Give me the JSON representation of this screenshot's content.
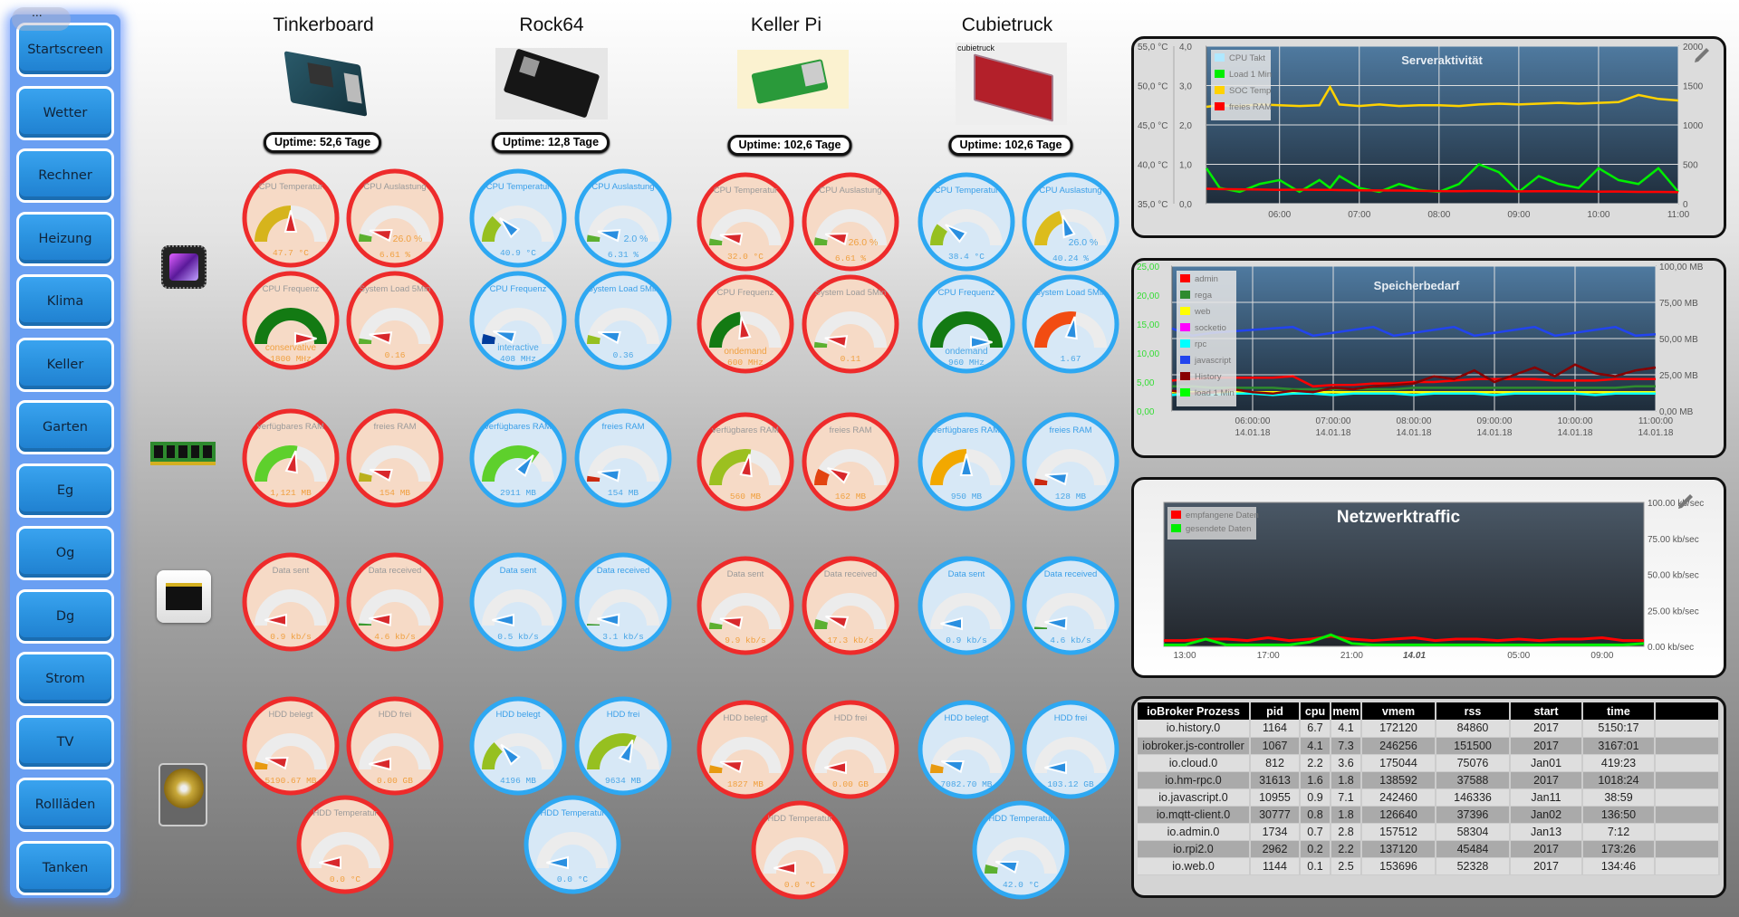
{
  "sidebar": {
    "menu_dots": "...",
    "items": [
      "Startscreen",
      "Wetter",
      "Rechner",
      "Heizung",
      "Klima",
      "Keller",
      "Garten",
      "Eg",
      "Og",
      "Dg",
      "Strom",
      "TV",
      "Rollläden",
      "Tanken"
    ]
  },
  "row_icons": [
    "cpu-chip-icon",
    "ram-module-icon",
    "ethernet-port-icon",
    "hard-disk-icon"
  ],
  "themes": {
    "red": {
      "border": "#ee2b2b",
      "bg": "#f6dac6",
      "title": "#9a9a9a",
      "value": "#f0a040",
      "needle": "#d8282c"
    },
    "blue": {
      "border": "#2ea8f2",
      "bg": "#d7e8f6",
      "title": "#3a9fe8",
      "value": "#4aa6e6",
      "needle": "#2a8fe0"
    }
  },
  "devices": [
    {
      "name": "Tinkerboard",
      "uptime": "Uptime: 52,6 Tage",
      "theme": "red",
      "gauges": [
        {
          "label": "CPU Temperatur",
          "value": "47.7 °C",
          "fill": 0.5,
          "color": "#d6b41c"
        },
        {
          "label": "CPU Auslastung",
          "extra": "26.0 %",
          "value": "6.61 %",
          "fill": 0.07,
          "color": "#5cb030"
        },
        {
          "label": "CPU Frequenz",
          "sub": "conservative",
          "value": "1800 MHz",
          "fill": 1.0,
          "color": "#137a13"
        },
        {
          "label": "System Load 5Min",
          "value": "0.16",
          "fill": 0.05,
          "color": "#5cb030"
        },
        {
          "label": "verfügbares RAM",
          "value": "1,121 MB",
          "fill": 0.56,
          "color": "#5ed02c"
        },
        {
          "label": "freies RAM",
          "value": "154 MB",
          "fill": 0.08,
          "color": "#bab01e"
        },
        {
          "label": "Data sent",
          "value": "0.9 kb/s",
          "fill": 0.0,
          "color": "#5cb030"
        },
        {
          "label": "Data received",
          "value": "4.6 kb/s",
          "fill": 0.02,
          "color": "#3a9a30"
        },
        {
          "label": "HDD belegt",
          "value": "5190.67 MB",
          "fill": 0.07,
          "color": "#e89a10"
        },
        {
          "label": "HDD frei",
          "value": "0.00 GB",
          "fill": 0.0,
          "color": "#5cb030"
        },
        {
          "label": "HDD Temperatur",
          "value": "0.0 °C",
          "fill": 0.0,
          "color": "#5cb030"
        }
      ]
    },
    {
      "name": "Rock64",
      "uptime": "Uptime: 12,8 Tage",
      "theme": "blue",
      "gauges": [
        {
          "label": "CPU Temperatur",
          "value": "40.9 °C",
          "fill": 0.25,
          "color": "#96c020"
        },
        {
          "label": "CPU Auslastung",
          "extra": "2.0 %",
          "value": "6.31 %",
          "fill": 0.06,
          "color": "#5cb030"
        },
        {
          "label": "CPU Frequenz",
          "sub": "interactive",
          "value": "408 MHz",
          "fill": 0.09,
          "color": "#003c9c"
        },
        {
          "label": "System Load 5Min",
          "value": "0.36",
          "fill": 0.08,
          "color": "#96c020"
        },
        {
          "label": "verfügbares RAM",
          "value": "2911 MB",
          "fill": 0.7,
          "color": "#5ed02c"
        },
        {
          "label": "freies RAM",
          "value": "154 MB",
          "fill": 0.05,
          "color": "#cc2a10"
        },
        {
          "label": "Data sent",
          "value": "0.5 kb/s",
          "fill": 0.0,
          "color": "#5cb030"
        },
        {
          "label": "Data received",
          "value": "3.1 kb/s",
          "fill": 0.015,
          "color": "#3a9a30"
        },
        {
          "label": "HDD belegt",
          "value": "4196 MB",
          "fill": 0.27,
          "color": "#96c020"
        },
        {
          "label": "HDD frei",
          "value": "9634 MB",
          "fill": 0.62,
          "color": "#96c020"
        },
        {
          "label": "HDD Temperatur",
          "value": "0.0 °C",
          "fill": 0.0,
          "color": "#5cb030"
        }
      ]
    },
    {
      "name": "Keller Pi",
      "uptime": "Uptime: 102,6 Tage",
      "theme": "red",
      "gauges": [
        {
          "label": "CPU Temperatur",
          "value": "32.0 °C",
          "fill": 0.06,
          "color": "#5cb030"
        },
        {
          "label": "CPU Auslastung",
          "extra": "26.0 %",
          "value": "6.61 %",
          "fill": 0.07,
          "color": "#5cb030"
        },
        {
          "label": "CPU Frequenz",
          "sub": "ondemand",
          "value": "600 MHz",
          "fill": 0.45,
          "color": "#137a13"
        },
        {
          "label": "System Load 5Min",
          "value": "0.11",
          "fill": 0.05,
          "color": "#5cb030"
        },
        {
          "label": "verfügbares RAM",
          "value": "560 MB",
          "fill": 0.55,
          "color": "#9cc020"
        },
        {
          "label": "freies RAM",
          "value": "162 MB",
          "fill": 0.15,
          "color": "#e24410"
        },
        {
          "label": "Data sent",
          "value": "9.9 kb/s",
          "fill": 0.06,
          "color": "#5cb030"
        },
        {
          "label": "Data received",
          "value": "17.3 kb/s",
          "fill": 0.09,
          "color": "#5cb030"
        },
        {
          "label": "HDD belegt",
          "value": "1827 MB",
          "fill": 0.07,
          "color": "#e89a10"
        },
        {
          "label": "HDD frei",
          "value": "0.00 GB",
          "fill": 0.0,
          "color": "#5cb030"
        },
        {
          "label": "HDD Temperatur",
          "value": "0.0 °C",
          "fill": 0.0,
          "color": "#5cb030"
        }
      ]
    },
    {
      "name": "Cubietruck",
      "image_label": "cubietruck",
      "uptime": "Uptime: 102,6 Tage",
      "theme": "blue",
      "gauges": [
        {
          "label": "CPU Temperatur",
          "value": "38.4 °C",
          "fill": 0.2,
          "color": "#96c020"
        },
        {
          "label": "CPU Auslastung",
          "extra": "26.0 %",
          "value": "40.24 %",
          "fill": 0.4,
          "color": "#dcbc1c"
        },
        {
          "label": "CPU Frequenz",
          "sub": "ondemand",
          "value": "960 MHz",
          "fill": 1.0,
          "color": "#137a13"
        },
        {
          "label": "System Load 5Min",
          "value": "1.67",
          "fill": 0.55,
          "color": "#f24c12"
        },
        {
          "label": "verfügbares RAM",
          "value": "950 MB",
          "fill": 0.5,
          "color": "#f2a800"
        },
        {
          "label": "freies RAM",
          "value": "128 MB",
          "fill": 0.06,
          "color": "#cc2a10"
        },
        {
          "label": "Data sent",
          "value": "0.9 kb/s",
          "fill": 0.0,
          "color": "#5cb030"
        },
        {
          "label": "Data received",
          "value": "4.6 kb/s",
          "fill": 0.02,
          "color": "#3a9a30"
        },
        {
          "label": "HDD belegt",
          "value": "7082.70 MB",
          "fill": 0.08,
          "color": "#e89a10"
        },
        {
          "label": "HDD frei",
          "value": "103.12 GB",
          "fill": 0.0,
          "color": "#5cb030"
        },
        {
          "label": "HDD Temperatur",
          "value": "42.0 °C",
          "fill": 0.08,
          "color": "#5cb030"
        }
      ]
    }
  ],
  "chart_data": [
    {
      "type": "line",
      "title": "Serveraktivität",
      "grid": true,
      "legend": "top-left",
      "x": [
        "05:05",
        "05:15",
        "05:30",
        "05:45",
        "06:00",
        "06:15",
        "06:30",
        "06:38",
        "06:45",
        "07:00",
        "07:15",
        "07:30",
        "07:45",
        "08:00",
        "08:15",
        "08:30",
        "08:45",
        "09:00",
        "09:15",
        "09:30",
        "09:45",
        "10:00",
        "10:15",
        "10:30",
        "10:45",
        "11:00"
      ],
      "xticks": [
        "06:00",
        "07:00",
        "08:00",
        "09:00",
        "10:00",
        "11:00"
      ],
      "axes": {
        "temp": {
          "ticks": [
            "35,0 °C",
            "40,0 °C",
            "45,0 °C",
            "50,0 °C",
            "55,0 °C"
          ],
          "range": [
            35,
            55
          ]
        },
        "load": {
          "ticks": [
            "0,0",
            "1,0",
            "2,0",
            "3,0",
            "4,0"
          ],
          "range": [
            0,
            4
          ]
        },
        "right": {
          "ticks": [
            "0",
            "500",
            "1000",
            "1500",
            "2000"
          ],
          "range": [
            0,
            2000
          ]
        }
      },
      "series": [
        {
          "name": "CPU Takt",
          "color": "#b0e8ff",
          "axis": "right",
          "values": []
        },
        {
          "name": "Load 1 Min",
          "color": "#00ee00",
          "axis": "load",
          "values": [
            0.9,
            0.4,
            0.3,
            0.5,
            0.6,
            0.3,
            0.6,
            0.4,
            0.7,
            0.4,
            0.3,
            0.5,
            0.35,
            0.3,
            0.5,
            1.0,
            0.8,
            0.3,
            0.7,
            0.5,
            0.4,
            0.9,
            0.6,
            0.5,
            0.9,
            0.3
          ]
        },
        {
          "name": "SOC Temp",
          "color": "#ffd200",
          "axis": "temp",
          "values": [
            47.3,
            47.5,
            47.4,
            47.6,
            47.5,
            47.4,
            47.5,
            49.8,
            47.6,
            47.4,
            47.6,
            47.4,
            47.5,
            47.5,
            47.4,
            47.6,
            47.7,
            47.6,
            47.7,
            47.8,
            47.7,
            47.8,
            47.9,
            48.8,
            48.3,
            48.1
          ]
        },
        {
          "name": "freies RAM",
          "color": "#ff0000",
          "axis": "right",
          "values": [
            190,
            185,
            182,
            180,
            176,
            178,
            175,
            175,
            172,
            170,
            168,
            166,
            164,
            160,
            158,
            162,
            160,
            156,
            158,
            160,
            156,
            152,
            154,
            150,
            150,
            146
          ]
        }
      ]
    },
    {
      "type": "line",
      "title": "Speicherbedarf",
      "grid": true,
      "legend": "top-left",
      "x": [
        "05:00",
        "05:15",
        "05:30",
        "05:45",
        "06:00",
        "06:15",
        "06:30",
        "06:45",
        "07:00",
        "07:15",
        "07:30",
        "07:45",
        "08:00",
        "08:15",
        "08:30",
        "08:45",
        "09:00",
        "09:15",
        "09:30",
        "09:45",
        "10:00",
        "10:15",
        "10:30",
        "10:45",
        "11:00"
      ],
      "xticks": [
        [
          "06:00:00",
          "14.01.18"
        ],
        [
          "07:00:00",
          "14.01.18"
        ],
        [
          "08:00:00",
          "14.01.18"
        ],
        [
          "09:00:00",
          "14.01.18"
        ],
        [
          "10:00:00",
          "14.01.18"
        ],
        [
          "11:00:00",
          "14.01.18"
        ]
      ],
      "axes": {
        "left": {
          "ticks": [
            "0,00",
            "5,00",
            "10,00",
            "15,00",
            "20,00",
            "25,00"
          ],
          "range": [
            0,
            25
          ],
          "color": "#33dd33"
        },
        "right": {
          "ticks": [
            "0,00 MB",
            "25,00 MB",
            "50,00 MB",
            "75,00 MB",
            "100,00 MB"
          ],
          "range": [
            0,
            100
          ]
        }
      },
      "series": [
        {
          "name": "admin",
          "color": "#ff0000",
          "values": [
            21,
            22,
            23,
            23,
            23,
            23,
            24,
            17,
            18,
            18,
            19,
            19,
            20,
            20,
            21,
            22,
            22,
            22,
            22,
            21,
            21,
            21,
            22,
            22,
            22
          ]
        },
        {
          "name": "rega",
          "color": "#2e8b2e",
          "values": [
            17,
            17,
            16,
            16,
            16,
            16,
            15,
            15,
            15,
            15,
            15,
            15,
            16,
            16,
            16,
            16,
            16,
            16,
            16,
            16,
            16,
            16,
            16,
            17,
            17
          ]
        },
        {
          "name": "web",
          "color": "#ffff00",
          "values": [
            13,
            13,
            13,
            13,
            13,
            13,
            13,
            13,
            13,
            13,
            13,
            13,
            13,
            13,
            13,
            13,
            13,
            13,
            13,
            13,
            13,
            13,
            13,
            13,
            13
          ]
        },
        {
          "name": "socketio",
          "color": "#ff00ff",
          "values": []
        },
        {
          "name": "rpc",
          "color": "#00ffff",
          "values": [
            11,
            12,
            11,
            12,
            12,
            11,
            12,
            12,
            11,
            12,
            12,
            12,
            11,
            12,
            12,
            12,
            11,
            12,
            12,
            12,
            12,
            11,
            12,
            12,
            12
          ]
        },
        {
          "name": "javascript",
          "color": "#2244ee",
          "values": [
            57,
            52,
            54,
            55,
            56,
            57,
            58,
            52,
            54,
            56,
            58,
            52,
            54,
            56,
            58,
            52,
            54,
            56,
            58,
            52,
            54,
            56,
            58,
            52,
            53
          ]
        },
        {
          "name": "History",
          "color": "#880000",
          "values": [
            14,
            12,
            13,
            15,
            13,
            12,
            14,
            13,
            16,
            15,
            17,
            18,
            19,
            24,
            22,
            28,
            20,
            25,
            30,
            24,
            32,
            26,
            24,
            28,
            30
          ]
        },
        {
          "name": "load 1 Min",
          "color": "#00ff00",
          "values": []
        }
      ]
    },
    {
      "type": "line",
      "title": "Netzwerktraffic",
      "grid": false,
      "legend": "top-left",
      "x": [
        "12:00",
        "13:00",
        "14:00",
        "15:00",
        "16:00",
        "17:00",
        "18:00",
        "19:00",
        "20:00",
        "21:00",
        "22:00",
        "23:00",
        "00:00",
        "01:00",
        "02:00",
        "03:00",
        "04:00",
        "05:00",
        "06:00",
        "07:00",
        "08:00",
        "09:00",
        "10:00",
        "11:00"
      ],
      "xticks": [
        "13:00",
        "17:00",
        "21:00",
        "14.01",
        "05:00",
        "09:00"
      ],
      "yticks": [
        "0.00 kb/sec",
        "25.00 kb/sec",
        "50.00 kb/sec",
        "75.00 kb/sec",
        "100.00 kb/sec"
      ],
      "ylim": [
        0,
        100
      ],
      "series": [
        {
          "name": "empfangene Daten",
          "color": "#ff0000",
          "values": [
            4,
            4,
            5,
            5,
            4,
            6,
            4,
            5,
            7,
            5,
            4,
            5,
            6,
            4,
            5,
            5,
            4,
            5,
            4,
            5,
            5,
            6,
            4,
            4
          ]
        },
        {
          "name": "gesendete Daten",
          "color": "#00ee00",
          "values": [
            1,
            1,
            5,
            1,
            1,
            1,
            1,
            3,
            8,
            2,
            1,
            1,
            1,
            1,
            1,
            1,
            1,
            1,
            1,
            1,
            1,
            1,
            1,
            2
          ]
        }
      ]
    }
  ],
  "table": {
    "headers": [
      "ioBroker Prozess",
      "pid",
      "cpu",
      "mem",
      "vmem",
      "rss",
      "start",
      "time",
      ""
    ],
    "rows": [
      [
        "io.history.0",
        "1164",
        "6.7",
        "4.1",
        "172120",
        "84860",
        "2017",
        "5150:17"
      ],
      [
        "iobroker.js-controller",
        "1067",
        "4.1",
        "7.3",
        "246256",
        "151500",
        "2017",
        "3167:01"
      ],
      [
        "io.cloud.0",
        "812",
        "2.2",
        "3.6",
        "175044",
        "75076",
        "Jan01",
        "419:23"
      ],
      [
        "io.hm-rpc.0",
        "31613",
        "1.6",
        "1.8",
        "138592",
        "37588",
        "2017",
        "1018:24"
      ],
      [
        "io.javascript.0",
        "10955",
        "0.9",
        "7.1",
        "242460",
        "146336",
        "Jan11",
        "38:59"
      ],
      [
        "io.mqtt-client.0",
        "30777",
        "0.8",
        "1.8",
        "126640",
        "37396",
        "Jan02",
        "136:50"
      ],
      [
        "io.admin.0",
        "1734",
        "0.7",
        "2.8",
        "157512",
        "58304",
        "Jan13",
        "7:12"
      ],
      [
        "io.rpi2.0",
        "2962",
        "0.2",
        "2.2",
        "137120",
        "45484",
        "2017",
        "173:26"
      ],
      [
        "io.web.0",
        "1144",
        "0.1",
        "2.5",
        "153696",
        "52328",
        "2017",
        "134:46"
      ]
    ]
  }
}
